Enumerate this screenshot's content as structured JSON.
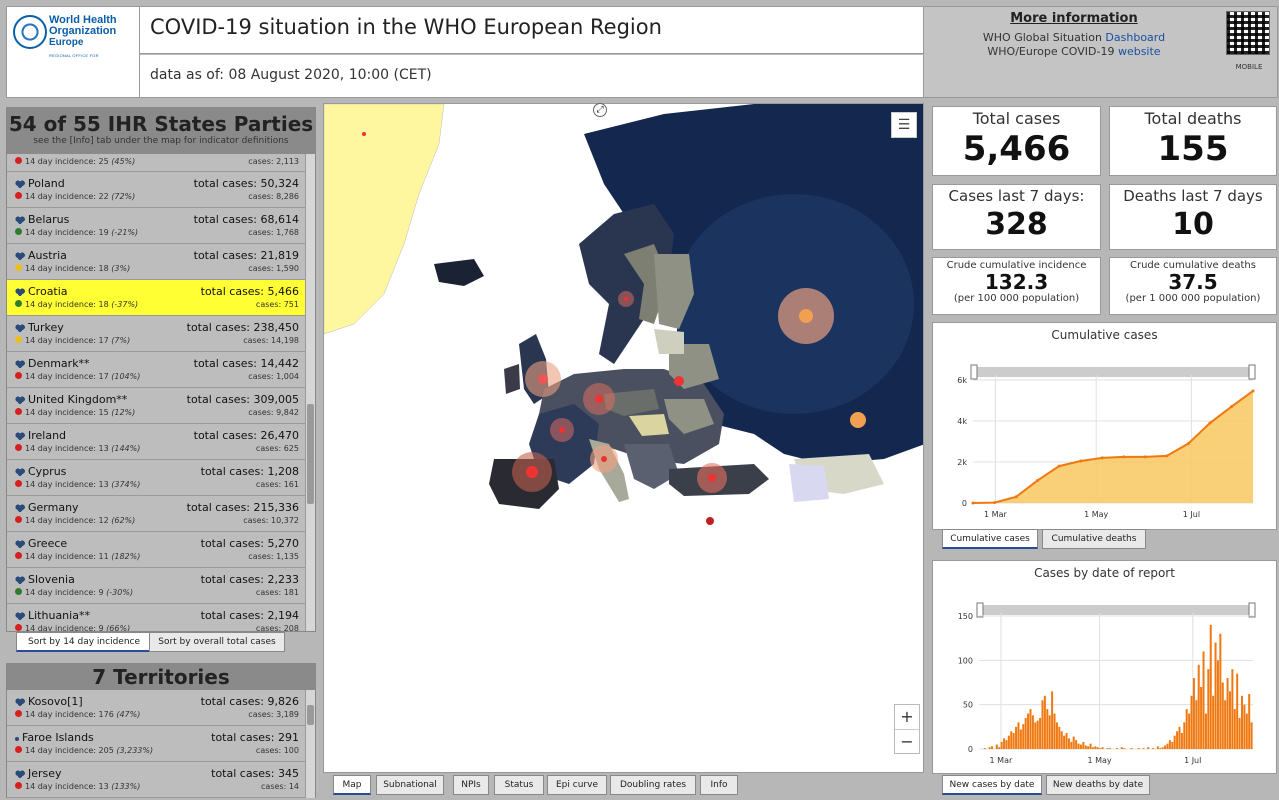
{
  "header": {
    "logo_line1": "World Health",
    "logo_line2": "Organization",
    "logo_line3": "Europe",
    "logo_small": "REGIONAL OFFICE FOR",
    "title": "COVID-19 situation in the WHO European Region",
    "date_text": "data as of: 08 August 2020, 10:00 (CET)",
    "more_title": "More information",
    "more_line1_prefix": "WHO Global Situation",
    "more_line1_link": "Dashboard",
    "more_line2_prefix": "WHO/Europe COVID-19",
    "more_line2_link": "website",
    "qr_label": "MOBILE"
  },
  "states_panel": {
    "title": "54 of 55 IHR States Parties",
    "subtitle": "see the [Info] tab under the map for indicator definitions",
    "rows": [
      {
        "name": "",
        "cases": "",
        "incidence": "14 day incidence: 25",
        "change": "(45%)",
        "cases_small": "cases: 2,113",
        "dot": "#d62020",
        "person": false,
        "highlight": false,
        "partial": true
      },
      {
        "name": "Poland",
        "cases": "total cases: 50,324",
        "incidence": "14 day incidence: 22",
        "change": "(72%)",
        "cases_small": "cases: 8,286",
        "dot": "#d62020",
        "person": true,
        "highlight": false
      },
      {
        "name": "Belarus",
        "cases": "total cases: 68,614",
        "incidence": "14 day incidence: 19",
        "change": "(-21%)",
        "cases_small": "cases: 1,768",
        "dot": "#2e7d2e",
        "person": true,
        "highlight": false
      },
      {
        "name": "Austria",
        "cases": "total cases: 21,819",
        "incidence": "14 day incidence: 18",
        "change": "(3%)",
        "cases_small": "cases: 1,590",
        "dot": "#e8c020",
        "person": true,
        "highlight": false
      },
      {
        "name": "Croatia",
        "cases": "total cases: 5,466",
        "incidence": "14 day incidence: 18",
        "change": "(-37%)",
        "cases_small": "cases: 751",
        "dot": "#2e7d2e",
        "person": true,
        "highlight": true
      },
      {
        "name": "Turkey",
        "cases": "total cases: 238,450",
        "incidence": "14 day incidence: 17",
        "change": "(7%)",
        "cases_small": "cases: 14,198",
        "dot": "#e8c020",
        "person": true,
        "highlight": false
      },
      {
        "name": "Denmark**",
        "cases": "total cases: 14,442",
        "incidence": "14 day incidence: 17",
        "change": "(104%)",
        "cases_small": "cases: 1,004",
        "dot": "#d62020",
        "person": true,
        "highlight": false
      },
      {
        "name": "United Kingdom**",
        "cases": "total cases: 309,005",
        "incidence": "14 day incidence: 15",
        "change": "(12%)",
        "cases_small": "cases: 9,842",
        "dot": "#d62020",
        "person": true,
        "highlight": false
      },
      {
        "name": "Ireland",
        "cases": "total cases: 26,470",
        "incidence": "14 day incidence: 13",
        "change": "(144%)",
        "cases_small": "cases: 625",
        "dot": "#d62020",
        "person": true,
        "highlight": false
      },
      {
        "name": "Cyprus",
        "cases": "total cases: 1,208",
        "incidence": "14 day incidence: 13",
        "change": "(374%)",
        "cases_small": "cases: 161",
        "dot": "#d62020",
        "person": true,
        "highlight": false
      },
      {
        "name": "Germany",
        "cases": "total cases: 215,336",
        "incidence": "14 day incidence: 12",
        "change": "(62%)",
        "cases_small": "cases: 10,372",
        "dot": "#d62020",
        "person": true,
        "highlight": false
      },
      {
        "name": "Greece",
        "cases": "total cases: 5,270",
        "incidence": "14 day incidence: 11",
        "change": "(182%)",
        "cases_small": "cases: 1,135",
        "dot": "#d62020",
        "person": true,
        "highlight": false
      },
      {
        "name": "Slovenia",
        "cases": "total cases: 2,233",
        "incidence": "14 day incidence: 9",
        "change": "(-30%)",
        "cases_small": "cases: 181",
        "dot": "#2e7d2e",
        "person": true,
        "highlight": false
      },
      {
        "name": "Lithuania**",
        "cases": "total cases: 2,194",
        "incidence": "14 day incidence: 9",
        "change": "(66%)",
        "cases_small": "cases: 208",
        "dot": "#d62020",
        "person": true,
        "highlight": false
      }
    ],
    "sort_buttons": [
      "Sort by 14 day incidence",
      "Sort by overall total cases"
    ]
  },
  "territories_panel": {
    "title": "7 Territories",
    "rows": [
      {
        "name": "Kosovo[1]",
        "cases": "total cases: 9,826",
        "incidence": "14 day incidence: 176",
        "change": "(47%)",
        "cases_small": "cases: 3,189",
        "dot": "#d62020",
        "person": true
      },
      {
        "name": "Faroe Islands",
        "cases": "total cases: 291",
        "incidence": "14 day incidence: 205",
        "change": "(3,233%)",
        "cases_small": "cases: 100",
        "dot": "#d62020",
        "person": false
      },
      {
        "name": "Jersey",
        "cases": "total cases: 345",
        "incidence": "14 day incidence: 13",
        "change": "(133%)",
        "cases_small": "cases: 14",
        "dot": "#d62020",
        "person": true
      }
    ]
  },
  "map": {
    "tabs": [
      "Map",
      "Subnational",
      "NPIs",
      "Status",
      "Epi curve",
      "Doubling rates",
      "Info"
    ],
    "zoom_in": "+",
    "zoom_out": "−",
    "layers_icon": "list-icon",
    "colors": {
      "sea": "#ffffff",
      "dark": "#1a2a48",
      "russia": "#14284f",
      "greenland": "#fff7a0"
    }
  },
  "stats": {
    "total_cases_label": "Total cases",
    "total_cases": "5,466",
    "total_deaths_label": "Total deaths",
    "total_deaths": "155",
    "cases7_label": "Cases last 7 days:",
    "cases7": "328",
    "deaths7_label": "Deaths last 7 days",
    "deaths7": "10",
    "crude_inc_label": "Crude cumulative incidence",
    "crude_inc": "132.3",
    "crude_inc_note": "(per 100 000 population)",
    "crude_death_label": "Crude cumulative deaths",
    "crude_death": "37.5",
    "crude_death_note": "(per 1 000 000 population)"
  },
  "cumulative_chart": {
    "title": "Cumulative cases",
    "tabs": [
      "Cumulative cases",
      "Cumulative deaths"
    ]
  },
  "daily_chart": {
    "title": "Cases by date of report",
    "tabs": [
      "New cases by date",
      "New deaths by date"
    ]
  },
  "chart_data": [
    {
      "type": "area",
      "title": "Cumulative cases",
      "x": [
        "2020-02-25",
        "2020-03-10",
        "2020-03-20",
        "2020-04-01",
        "2020-04-15",
        "2020-05-01",
        "2020-05-15",
        "2020-06-01",
        "2020-06-15",
        "2020-06-25",
        "2020-07-05",
        "2020-07-15",
        "2020-07-25",
        "2020-08-08"
      ],
      "values": [
        0,
        20,
        300,
        1100,
        1800,
        2050,
        2200,
        2250,
        2250,
        2300,
        2900,
        3900,
        4700,
        5466
      ],
      "xticks": [
        "1 Mar",
        "1 May",
        "1 Jul"
      ],
      "yticks": [
        "0",
        "2k",
        "4k",
        "6k"
      ],
      "ylim": [
        0,
        6000
      ],
      "color": "#f3a020"
    },
    {
      "type": "bar",
      "title": "Cases by date of report",
      "values": [
        0,
        0,
        1,
        0,
        2,
        3,
        0,
        5,
        2,
        8,
        12,
        10,
        15,
        20,
        18,
        25,
        30,
        22,
        28,
        35,
        40,
        45,
        38,
        30,
        32,
        35,
        55,
        60,
        45,
        38,
        65,
        40,
        30,
        25,
        20,
        15,
        18,
        12,
        8,
        14,
        10,
        6,
        5,
        8,
        4,
        3,
        6,
        2,
        3,
        2,
        1,
        2,
        0,
        1,
        1,
        0,
        0,
        1,
        0,
        2,
        1,
        0,
        0,
        1,
        0,
        0,
        1,
        0,
        1,
        0,
        2,
        0,
        1,
        0,
        3,
        1,
        2,
        4,
        6,
        10,
        8,
        15,
        20,
        25,
        18,
        30,
        45,
        40,
        60,
        80,
        55,
        95,
        70,
        110,
        40,
        90,
        140,
        60,
        120,
        100,
        130,
        75,
        55,
        80,
        65,
        90,
        45,
        85,
        35,
        60,
        50,
        40,
        62,
        30
      ],
      "xticks": [
        "1 Mar",
        "1 May",
        "1 Jul"
      ],
      "yticks": [
        "0",
        "50",
        "100",
        "150"
      ],
      "ylim": [
        0,
        150
      ],
      "color": "#f07810"
    }
  ]
}
